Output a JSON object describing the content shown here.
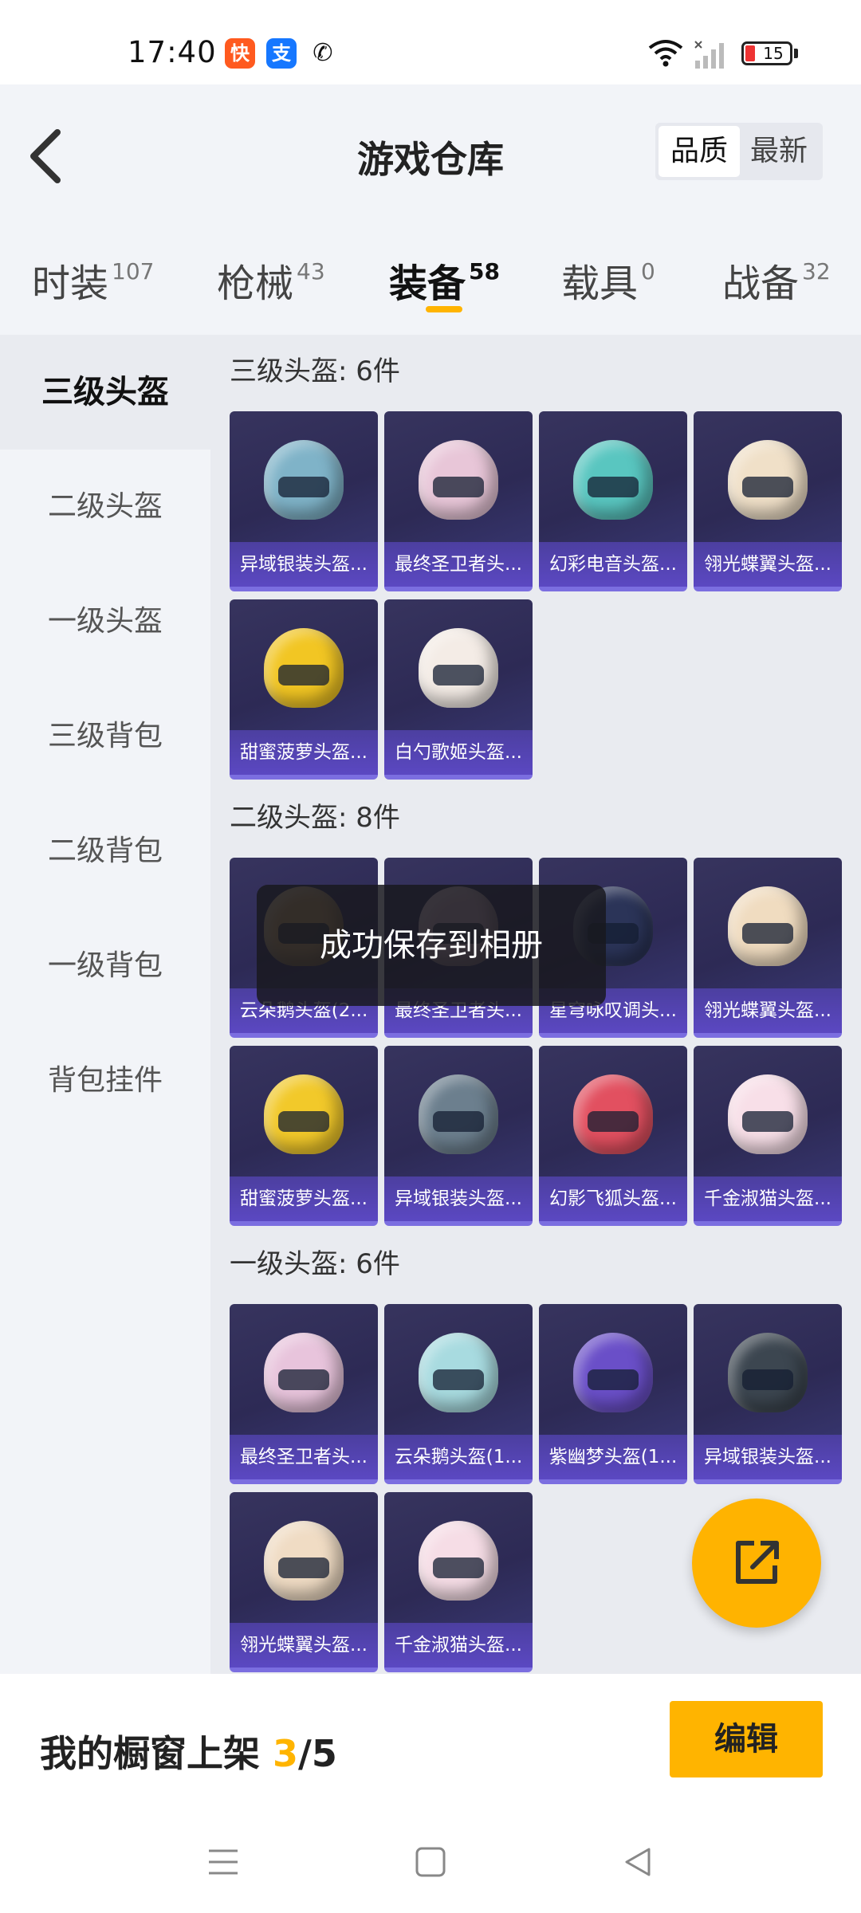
{
  "status_bar": {
    "time": "17:40",
    "apps": [
      "kuaishou-icon",
      "alipay-icon",
      "wechat-icon"
    ],
    "app_glyphs": [
      "快",
      "支",
      "✆"
    ],
    "battery_level": "15"
  },
  "header": {
    "title": "游戏仓库",
    "sort_options": [
      "品质",
      "最新"
    ],
    "selected_sort": "品质"
  },
  "tabs": [
    {
      "label": "时装",
      "count": "107"
    },
    {
      "label": "枪械",
      "count": "43"
    },
    {
      "label": "装备",
      "count": "58",
      "active": true
    },
    {
      "label": "载具",
      "count": "0"
    },
    {
      "label": "战备",
      "count": "32"
    }
  ],
  "sidebar": {
    "items": [
      "三级头盔",
      "二级头盔",
      "一级头盔",
      "三级背包",
      "二级背包",
      "一级背包",
      "背包挂件"
    ],
    "active": "三级头盔"
  },
  "sections": [
    {
      "title": "三级头盔: 6件",
      "items": [
        {
          "label": "异域银装头盔...",
          "color": "#7fb3c8"
        },
        {
          "label": "最终圣卫者头...",
          "color": "#e8c6d8"
        },
        {
          "label": "幻彩电音头盔...",
          "color": "#59c6c0"
        },
        {
          "label": "翎光蝶翼头盔...",
          "color": "#f0e0c8"
        },
        {
          "label": "甜蜜菠萝头盔...",
          "color": "#f2c623"
        },
        {
          "label": "白勺歌姬头盔...",
          "color": "#f4ece6"
        }
      ]
    },
    {
      "title": "二级头盔: 8件",
      "items": [
        {
          "label": "云朵鹅头盔(2...",
          "color": "#c9a060"
        },
        {
          "label": "最终圣卫者头...",
          "color": "#d8b6c8"
        },
        {
          "label": "星穹咏叹调头...",
          "color": "#2b3458"
        },
        {
          "label": "翎光蝶翼头盔...",
          "color": "#f0dcc0"
        },
        {
          "label": "甜蜜菠萝头盔...",
          "color": "#f2c92a"
        },
        {
          "label": "异域银装头盔...",
          "color": "#6c7f8e"
        },
        {
          "label": "幻影飞狐头盔...",
          "color": "#e25060"
        },
        {
          "label": "千金淑猫头盔...",
          "color": "#f8dfe8"
        }
      ]
    },
    {
      "title": "一级头盔: 6件",
      "items": [
        {
          "label": "最终圣卫者头...",
          "color": "#e8c4dc"
        },
        {
          "label": "云朵鹅头盔(1...",
          "color": "#a8dbe0"
        },
        {
          "label": "紫幽梦头盔(1...",
          "color": "#6a4fc8"
        },
        {
          "label": "异域银装头盔...",
          "color": "#3c4650"
        },
        {
          "label": "翎光蝶翼头盔...",
          "color": "#f0dcc4"
        },
        {
          "label": "千金淑猫头盔...",
          "color": "#f6dde6"
        }
      ]
    }
  ],
  "toast": "成功保存到相册",
  "showcase": {
    "label": "我的橱窗上架",
    "current": "3",
    "total": "/5",
    "edit_label": "编辑"
  },
  "colors": {
    "accent": "#ffb400",
    "card_bg": "#2d2a55",
    "card_label_bg": "#5b48c2"
  }
}
